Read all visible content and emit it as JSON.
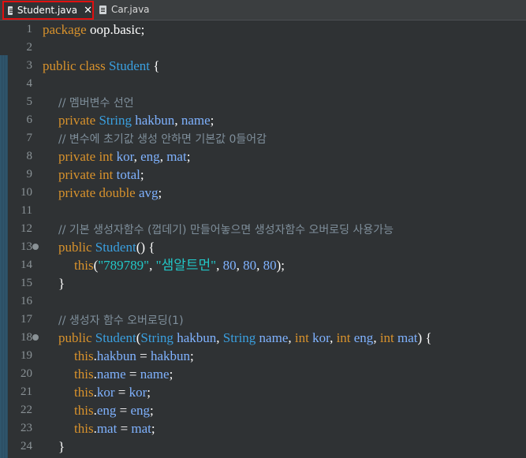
{
  "tabs": [
    {
      "label": "Student.java",
      "close": "✕",
      "active": true
    },
    {
      "label": "Car.java",
      "active": false
    }
  ],
  "colors": {
    "keyword": "#d8922c",
    "type": "#3aa0e0",
    "field": "#7fb2ff",
    "comment": "#7f8f9b",
    "string": "#22c7c7",
    "background": "#2f3234"
  },
  "lines": [
    {
      "n": "1",
      "fold": false,
      "indent": 0,
      "tokens": [
        [
          "kw",
          "package"
        ],
        [
          "pl",
          " oop.basic;"
        ]
      ]
    },
    {
      "n": "2",
      "fold": false,
      "indent": 0,
      "tokens": []
    },
    {
      "n": "3",
      "fold": false,
      "indent": 0,
      "tokens": [
        [
          "kw",
          "public class"
        ],
        [
          "pl",
          " "
        ],
        [
          "ty",
          "Student"
        ],
        [
          "pl",
          " {"
        ]
      ]
    },
    {
      "n": "4",
      "fold": false,
      "indent": 0,
      "tokens": []
    },
    {
      "n": "5",
      "fold": false,
      "indent": 1,
      "tokens": [
        [
          "cm",
          "// 멤버변수 선언"
        ]
      ]
    },
    {
      "n": "6",
      "fold": false,
      "indent": 1,
      "tokens": [
        [
          "kw",
          "private"
        ],
        [
          "pl",
          " "
        ],
        [
          "ty",
          "String"
        ],
        [
          "pl",
          " "
        ],
        [
          "fd",
          "hakbun"
        ],
        [
          "pl",
          ", "
        ],
        [
          "fd",
          "name"
        ],
        [
          "pl",
          ";"
        ]
      ]
    },
    {
      "n": "7",
      "fold": false,
      "indent": 1,
      "tokens": [
        [
          "cm",
          "// 변수에 초기값 생성 안하면 기본값 0들어감"
        ]
      ]
    },
    {
      "n": "8",
      "fold": false,
      "indent": 1,
      "tokens": [
        [
          "kw",
          "private int"
        ],
        [
          "pl",
          " "
        ],
        [
          "fd",
          "kor"
        ],
        [
          "pl",
          ", "
        ],
        [
          "fd",
          "eng"
        ],
        [
          "pl",
          ", "
        ],
        [
          "fd",
          "mat"
        ],
        [
          "pl",
          ";"
        ]
      ]
    },
    {
      "n": "9",
      "fold": false,
      "indent": 1,
      "tokens": [
        [
          "kw",
          "private int"
        ],
        [
          "pl",
          " "
        ],
        [
          "fd",
          "total"
        ],
        [
          "pl",
          ";"
        ]
      ]
    },
    {
      "n": "10",
      "fold": false,
      "indent": 1,
      "tokens": [
        [
          "kw",
          "private double"
        ],
        [
          "pl",
          " "
        ],
        [
          "fd",
          "avg"
        ],
        [
          "pl",
          ";"
        ]
      ]
    },
    {
      "n": "11",
      "fold": false,
      "indent": 0,
      "tokens": []
    },
    {
      "n": "12",
      "fold": false,
      "indent": 1,
      "tokens": [
        [
          "cm",
          "// 기본 생성자함수 (껍데기) 만들어놓으면 생성자함수 오버로딩 사용가능"
        ]
      ]
    },
    {
      "n": "13",
      "fold": true,
      "indent": 1,
      "tokens": [
        [
          "kw",
          "public"
        ],
        [
          "pl",
          " "
        ],
        [
          "ty",
          "Student"
        ],
        [
          "pl",
          "() {"
        ]
      ]
    },
    {
      "n": "14",
      "fold": false,
      "indent": 2,
      "tokens": [
        [
          "kw",
          "this"
        ],
        [
          "pl",
          "("
        ],
        [
          "st",
          "\"789789\""
        ],
        [
          "pl",
          ", "
        ],
        [
          "st",
          "\"샘알트먼\""
        ],
        [
          "pl",
          ", "
        ],
        [
          "nm",
          "80"
        ],
        [
          "pl",
          ", "
        ],
        [
          "nm",
          "80"
        ],
        [
          "pl",
          ", "
        ],
        [
          "nm",
          "80"
        ],
        [
          "pl",
          ");"
        ]
      ]
    },
    {
      "n": "15",
      "fold": false,
      "indent": 1,
      "tokens": [
        [
          "pl",
          "}"
        ]
      ]
    },
    {
      "n": "16",
      "fold": false,
      "indent": 0,
      "tokens": []
    },
    {
      "n": "17",
      "fold": false,
      "indent": 1,
      "tokens": [
        [
          "cm",
          "// 생성자 함수 오버로딩(1)"
        ]
      ]
    },
    {
      "n": "18",
      "fold": true,
      "indent": 1,
      "tokens": [
        [
          "kw",
          "public"
        ],
        [
          "pl",
          " "
        ],
        [
          "ty",
          "Student"
        ],
        [
          "pl",
          "("
        ],
        [
          "ty",
          "String"
        ],
        [
          "pl",
          " "
        ],
        [
          "fd",
          "hakbun"
        ],
        [
          "pl",
          ", "
        ],
        [
          "ty",
          "String"
        ],
        [
          "pl",
          " "
        ],
        [
          "fd",
          "name"
        ],
        [
          "pl",
          ", "
        ],
        [
          "kw",
          "int"
        ],
        [
          "pl",
          " "
        ],
        [
          "fd",
          "kor"
        ],
        [
          "pl",
          ", "
        ],
        [
          "kw",
          "int"
        ],
        [
          "pl",
          " "
        ],
        [
          "fd",
          "eng"
        ],
        [
          "pl",
          ", "
        ],
        [
          "kw",
          "int"
        ],
        [
          "pl",
          " "
        ],
        [
          "fd",
          "mat"
        ],
        [
          "pl",
          ") {"
        ]
      ]
    },
    {
      "n": "19",
      "fold": false,
      "indent": 2,
      "tokens": [
        [
          "kw",
          "this"
        ],
        [
          "pl",
          "."
        ],
        [
          "fd",
          "hakbun"
        ],
        [
          "pl",
          " = "
        ],
        [
          "fd",
          "hakbun"
        ],
        [
          "pl",
          ";"
        ]
      ]
    },
    {
      "n": "20",
      "fold": false,
      "indent": 2,
      "tokens": [
        [
          "kw",
          "this"
        ],
        [
          "pl",
          "."
        ],
        [
          "fd",
          "name"
        ],
        [
          "pl",
          " = "
        ],
        [
          "fd",
          "name"
        ],
        [
          "pl",
          ";"
        ]
      ]
    },
    {
      "n": "21",
      "fold": false,
      "indent": 2,
      "tokens": [
        [
          "kw",
          "this"
        ],
        [
          "pl",
          "."
        ],
        [
          "fd",
          "kor"
        ],
        [
          "pl",
          " = "
        ],
        [
          "fd",
          "kor"
        ],
        [
          "pl",
          ";"
        ]
      ]
    },
    {
      "n": "22",
      "fold": false,
      "indent": 2,
      "tokens": [
        [
          "kw",
          "this"
        ],
        [
          "pl",
          "."
        ],
        [
          "fd",
          "eng"
        ],
        [
          "pl",
          " = "
        ],
        [
          "fd",
          "eng"
        ],
        [
          "pl",
          ";"
        ]
      ]
    },
    {
      "n": "23",
      "fold": false,
      "indent": 2,
      "tokens": [
        [
          "kw",
          "this"
        ],
        [
          "pl",
          "."
        ],
        [
          "fd",
          "mat"
        ],
        [
          "pl",
          " = "
        ],
        [
          "fd",
          "mat"
        ],
        [
          "pl",
          ";"
        ]
      ]
    },
    {
      "n": "24",
      "fold": false,
      "indent": 1,
      "tokens": [
        [
          "pl",
          "}"
        ]
      ]
    }
  ]
}
